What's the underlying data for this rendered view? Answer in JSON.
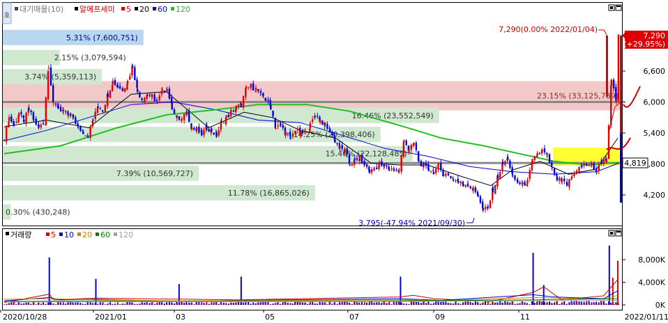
{
  "price_panel": {
    "legend": {
      "title": "대기매물(10)",
      "stock": "알에프세미",
      "ma_items": [
        {
          "label": "5",
          "color": "#d00000"
        },
        {
          "label": "20",
          "color": "#000000"
        },
        {
          "label": "60",
          "color": "#0000d0"
        },
        {
          "label": "120",
          "color": "#20c020"
        }
      ]
    },
    "corner_icon": "호",
    "high_label": "7,290(0.00% 2022/01/04)",
    "low_label": "3,795(-47.94% 2021/09/30)",
    "last_price_box": {
      "price": "7,290",
      "change": "(+29.95%)",
      "color": "#dd0000"
    },
    "current_level_box": "4,819"
  },
  "volume_panel": {
    "legend": {
      "title": "거래량",
      "ma_items": [
        {
          "label": "5",
          "color": "#d00000"
        },
        {
          "label": "10",
          "color": "#0000d0"
        },
        {
          "label": "20",
          "color": "#d08000"
        },
        {
          "label": "60",
          "color": "#008000"
        },
        {
          "label": "120",
          "color": "#a0a0a0"
        }
      ]
    }
  },
  "chart_data": {
    "type": "candlestick",
    "price_axis": {
      "ticks": [
        "6,600",
        "6,000",
        "5,400",
        "4,800",
        "4,200"
      ],
      "ylim": [
        3700,
        7350
      ]
    },
    "volume_axis": {
      "ticks": [
        "8,000K",
        "4,000K",
        "0K"
      ],
      "ylim": [
        0,
        11200
      ]
    },
    "x_ticks": [
      "2020/10/28",
      "2021/01",
      "03",
      "05",
      "07",
      "09",
      "11",
      "2022/01/11"
    ],
    "volume_profile": [
      {
        "label": "5.31% (7,600,751)",
        "price": 7250,
        "highlight": true
      },
      {
        "label": "2.15% (3,079,594)",
        "price": 6860
      },
      {
        "label": "3.74% (5,359,113)",
        "price": 6490
      },
      {
        "label": "23.15% (33,125,789)",
        "price": 6120,
        "max": true
      },
      {
        "label": "16.46% (23,552,549)",
        "price": 5740
      },
      {
        "label": "14.25% (20,398,406)",
        "price": 5370
      },
      {
        "label": "15.46% (22,128,485)",
        "price": 5000
      },
      {
        "label": "7.39% (10,569,727)",
        "price": 4620
      },
      {
        "label": "11.78% (16,865,026)",
        "price": 4240
      },
      {
        "label": "0.30% (430,248)",
        "price": 3870
      }
    ],
    "price_series": [
      [
        0,
        5300
      ],
      [
        7,
        5700
      ],
      [
        14,
        5550
      ],
      [
        21,
        5780
      ],
      [
        28,
        5640
      ],
      [
        35,
        5850
      ],
      [
        42,
        5650
      ],
      [
        49,
        5500
      ],
      [
        56,
        5600
      ],
      [
        63,
        6700
      ],
      [
        70,
        5950
      ],
      [
        77,
        5900
      ],
      [
        84,
        5800
      ],
      [
        91,
        5750
      ],
      [
        98,
        5700
      ],
      [
        105,
        5500
      ],
      [
        112,
        5420
      ],
      [
        119,
        5350
      ],
      [
        126,
        5650
      ],
      [
        133,
        5920
      ],
      [
        140,
        5850
      ],
      [
        147,
        6150
      ],
      [
        154,
        6400
      ],
      [
        161,
        6300
      ],
      [
        168,
        6250
      ],
      [
        175,
        6400
      ],
      [
        182,
        6700
      ],
      [
        189,
        6200
      ],
      [
        196,
        6050
      ],
      [
        203,
        6150
      ],
      [
        210,
        6100
      ],
      [
        217,
        6000
      ],
      [
        224,
        6200
      ],
      [
        231,
        6250
      ],
      [
        238,
        5900
      ],
      [
        245,
        5700
      ],
      [
        252,
        5650
      ],
      [
        259,
        5800
      ],
      [
        266,
        5500
      ],
      [
        273,
        5450
      ],
      [
        280,
        5380
      ],
      [
        287,
        5500
      ],
      [
        294,
        5450
      ],
      [
        301,
        5350
      ],
      [
        308,
        5600
      ],
      [
        315,
        5700
      ],
      [
        322,
        5800
      ],
      [
        329,
        5900
      ],
      [
        336,
        5950
      ],
      [
        343,
        6250
      ],
      [
        350,
        6300
      ],
      [
        357,
        6250
      ],
      [
        364,
        6150
      ],
      [
        371,
        6050
      ],
      [
        378,
        5900
      ],
      [
        385,
        5500
      ],
      [
        392,
        5550
      ],
      [
        399,
        5400
      ],
      [
        406,
        5300
      ],
      [
        413,
        5450
      ],
      [
        420,
        5400
      ],
      [
        427,
        5400
      ],
      [
        434,
        5550
      ],
      [
        441,
        5750
      ],
      [
        448,
        5650
      ],
      [
        455,
        5550
      ],
      [
        462,
        5450
      ],
      [
        469,
        5250
      ],
      [
        476,
        5100
      ],
      [
        483,
        5050
      ],
      [
        490,
        4800
      ],
      [
        497,
        4850
      ],
      [
        504,
        4900
      ],
      [
        511,
        4800
      ],
      [
        518,
        4650
      ],
      [
        525,
        4700
      ],
      [
        532,
        4800
      ],
      [
        539,
        4750
      ],
      [
        546,
        4700
      ],
      [
        553,
        4700
      ],
      [
        560,
        4650
      ],
      [
        567,
        5300
      ],
      [
        574,
        5050
      ],
      [
        581,
        5200
      ],
      [
        588,
        4850
      ],
      [
        595,
        4750
      ],
      [
        602,
        4700
      ],
      [
        609,
        4650
      ],
      [
        616,
        4750
      ],
      [
        623,
        4600
      ],
      [
        630,
        4600
      ],
      [
        637,
        4500
      ],
      [
        644,
        4450
      ],
      [
        651,
        4400
      ],
      [
        658,
        4400
      ],
      [
        665,
        4300
      ],
      [
        672,
        4200
      ],
      [
        679,
        3900
      ],
      [
        686,
        3950
      ],
      [
        693,
        4300
      ],
      [
        700,
        4550
      ],
      [
        707,
        4800
      ],
      [
        714,
        4900
      ],
      [
        721,
        4550
      ],
      [
        728,
        4450
      ],
      [
        735,
        4400
      ],
      [
        742,
        4450
      ],
      [
        749,
        4850
      ],
      [
        756,
        5000
      ],
      [
        763,
        5050
      ],
      [
        770,
        4950
      ],
      [
        777,
        4700
      ],
      [
        784,
        4500
      ],
      [
        791,
        4450
      ],
      [
        798,
        4400
      ],
      [
        805,
        4550
      ],
      [
        812,
        4700
      ],
      [
        819,
        4750
      ],
      [
        826,
        4800
      ],
      [
        833,
        4780
      ],
      [
        840,
        4650
      ],
      [
        847,
        4850
      ],
      [
        854,
        4900
      ],
      [
        861,
        6400
      ],
      [
        868,
        6000
      ],
      [
        871,
        7290
      ]
    ],
    "ma_lines": [
      {
        "name": "5",
        "color": "#d00000",
        "values": [
          [
            858,
            5450
          ],
          [
            866,
            5900
          ],
          [
            874,
            6000
          ]
        ]
      },
      {
        "name": "20",
        "color": "#000000",
        "values": [
          [
            0,
            5520
          ],
          [
            60,
            5650
          ],
          [
            120,
            5500
          ],
          [
            180,
            6150
          ],
          [
            230,
            6200
          ],
          [
            290,
            5500
          ],
          [
            340,
            5800
          ],
          [
            380,
            5700
          ],
          [
            420,
            5450
          ],
          [
            470,
            5300
          ],
          [
            520,
            4820
          ],
          [
            560,
            4780
          ],
          [
            600,
            4780
          ],
          [
            650,
            4550
          ],
          [
            690,
            4380
          ],
          [
            720,
            4680
          ],
          [
            760,
            4850
          ],
          [
            800,
            4600
          ],
          [
            840,
            4700
          ],
          [
            870,
            5300
          ]
        ]
      },
      {
        "name": "60",
        "color": "#0000d0",
        "values": [
          [
            0,
            5250
          ],
          [
            60,
            5450
          ],
          [
            120,
            5700
          ],
          [
            180,
            5950
          ],
          [
            240,
            6000
          ],
          [
            300,
            5850
          ],
          [
            360,
            5650
          ],
          [
            420,
            5600
          ],
          [
            480,
            5350
          ],
          [
            540,
            5100
          ],
          [
            600,
            4950
          ],
          [
            660,
            4750
          ],
          [
            720,
            4650
          ],
          [
            780,
            4600
          ],
          [
            840,
            4650
          ],
          [
            872,
            4820
          ]
        ]
      },
      {
        "name": "120",
        "color": "#20c020",
        "values": [
          [
            0,
            5000
          ],
          [
            80,
            5150
          ],
          [
            160,
            5500
          ],
          [
            230,
            5750
          ],
          [
            300,
            5850
          ],
          [
            360,
            5950
          ],
          [
            430,
            5950
          ],
          [
            490,
            5820
          ],
          [
            560,
            5550
          ],
          [
            620,
            5300
          ],
          [
            680,
            5150
          ],
          [
            730,
            5000
          ],
          [
            780,
            4850
          ],
          [
            830,
            4780
          ],
          [
            870,
            4830
          ]
        ]
      }
    ],
    "volume_ma_lines": [
      {
        "name": "5",
        "color": "#d00000",
        "values": [
          [
            0,
            400
          ],
          [
            64,
            1900
          ],
          [
            70,
            900
          ],
          [
            130,
            1200
          ],
          [
            330,
            900
          ],
          [
            560,
            1400
          ],
          [
            580,
            1700
          ],
          [
            610,
            1100
          ],
          [
            690,
            600
          ],
          [
            750,
            2200
          ],
          [
            765,
            3200
          ],
          [
            790,
            900
          ],
          [
            850,
            1600
          ],
          [
            870,
            4500
          ]
        ]
      },
      {
        "name": "10",
        "color": "#0000d0",
        "values": [
          [
            0,
            700
          ],
          [
            64,
            1300
          ],
          [
            80,
            900
          ],
          [
            130,
            1000
          ],
          [
            250,
            600
          ],
          [
            330,
            800
          ],
          [
            560,
            1100
          ],
          [
            620,
            800
          ],
          [
            750,
            1800
          ],
          [
            780,
            1400
          ],
          [
            850,
            1100
          ],
          [
            870,
            2500
          ]
        ]
      },
      {
        "name": "20",
        "color": "#d08000",
        "values": [
          [
            0,
            1000
          ],
          [
            64,
            1100
          ],
          [
            130,
            900
          ],
          [
            250,
            700
          ],
          [
            330,
            750
          ],
          [
            560,
            900
          ],
          [
            620,
            750
          ],
          [
            750,
            1300
          ],
          [
            850,
            1000
          ],
          [
            870,
            1700
          ]
        ]
      },
      {
        "name": "60",
        "color": "#008000",
        "values": [
          [
            0,
            600
          ],
          [
            130,
            700
          ],
          [
            250,
            600
          ],
          [
            560,
            700
          ],
          [
            750,
            900
          ],
          [
            870,
            1100
          ]
        ]
      },
      {
        "name": "120",
        "color": "#a0a0a0",
        "values": [
          [
            0,
            500
          ],
          [
            250,
            550
          ],
          [
            560,
            600
          ],
          [
            870,
            800
          ]
        ]
      }
    ],
    "volume_spikes": [
      [
        64,
        8400
      ],
      [
        130,
        4600
      ],
      [
        248,
        3700
      ],
      [
        336,
        5000
      ],
      [
        562,
        5000
      ],
      [
        750,
        9200
      ],
      [
        765,
        3500
      ],
      [
        858,
        10500
      ],
      [
        863,
        4800
      ],
      [
        870,
        7800
      ]
    ]
  }
}
